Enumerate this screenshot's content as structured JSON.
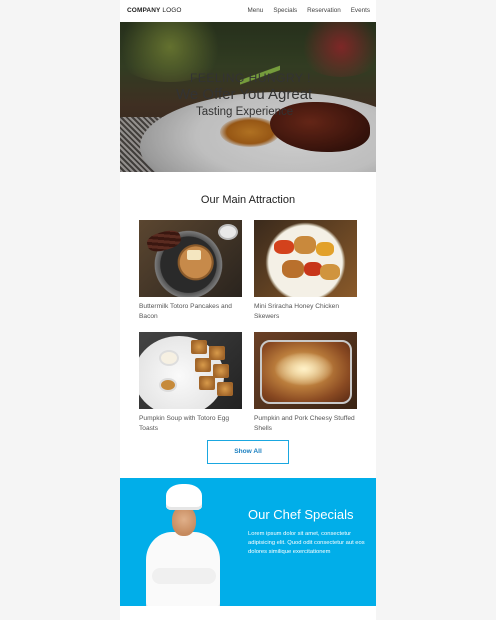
{
  "header": {
    "logo_bold": "COMPANY",
    "logo_rest": " LOGO",
    "nav": [
      "Menu",
      "Specials",
      "Reservation",
      "Events"
    ]
  },
  "hero": {
    "line1": "FEELING HUNGRY !",
    "line2": "We Offer You Agreat",
    "line3": "Tasting Experience"
  },
  "main": {
    "title": "Our Main Attraction",
    "items": [
      {
        "caption": "Buttermilk Totoro Pancakes and Bacon"
      },
      {
        "caption": "Mini Sriracha Honey Chicken Skewers"
      },
      {
        "caption": "Pumpkin Soup with Totoro Egg Toasts"
      },
      {
        "caption": "Pumpkin and Pork Cheesy Stuffed Shells"
      }
    ],
    "show_all": "Show All"
  },
  "chef": {
    "title": "Our Chef Specials",
    "description": "Lorem ipsum dolor sit amet, consectetur adipisicing elit. Quod odit consectetur aut eos dolores similique exercitationem"
  },
  "colors": {
    "accent": "#01aee9",
    "button_border": "#1aa7e0",
    "card_bg": "#ffffff",
    "page_bg": "#f5f5f5"
  }
}
